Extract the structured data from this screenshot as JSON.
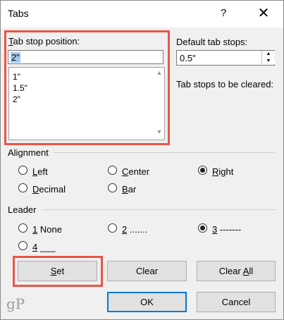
{
  "window": {
    "title": "Tabs",
    "help": "?",
    "close": "✕"
  },
  "tab_stop": {
    "label_underlined": "T",
    "label_rest": "ab stop position:",
    "value": "2\"",
    "list": [
      "1\"",
      "1.5\"",
      "2\""
    ]
  },
  "default_tab_stops": {
    "label": "Default tab stops:",
    "value": "0.5\""
  },
  "tabs_to_clear": {
    "label": "Tab stops to be cleared:"
  },
  "alignment": {
    "label": "Alignment",
    "options": [
      {
        "u": "L",
        "rest": "eft",
        "checked": false
      },
      {
        "u": "C",
        "rest": "enter",
        "checked": false
      },
      {
        "u": "R",
        "rest": "ight",
        "checked": true
      },
      {
        "u": "D",
        "rest": "ecimal",
        "checked": false
      },
      {
        "u": "B",
        "rest": "ar",
        "checked": false
      }
    ]
  },
  "leader": {
    "label": "Leader",
    "options": [
      {
        "u": "1",
        "rest": " None",
        "checked": false
      },
      {
        "u": "2",
        "rest": " .......",
        "checked": false
      },
      {
        "u": "3",
        "rest": " -------",
        "checked": true
      },
      {
        "u": "4",
        "rest": " ___",
        "checked": false
      }
    ]
  },
  "buttons": {
    "set_u": "S",
    "set_rest": "et",
    "clear": "Clear",
    "clear_all_pre": "Clear ",
    "clear_all_u": "A",
    "clear_all_rest": "ll",
    "ok": "OK",
    "cancel": "Cancel"
  },
  "watermark": "gP",
  "colors": {
    "highlight": "#ea5547",
    "selection": "#9fcbf2",
    "focus": "#0078d7"
  }
}
